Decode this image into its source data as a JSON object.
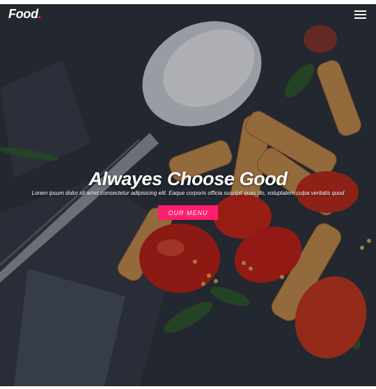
{
  "navbar": {
    "brand": "Food",
    "brand_dot": ".",
    "menu_icon": "hamburger-menu-icon"
  },
  "hero": {
    "headline": "Alwayes Choose Good",
    "subtitle": "Lorem ipsum dolor sit amet consectetur adipisicing elit. Eaque corporis officia suscipit quas illo, voluptatem culpa veritatis quod",
    "cta_label": "OUR MENU",
    "background_image": "pasta-dish-photo"
  },
  "colors": {
    "accent": "#ff1e6e",
    "text": "#ffffff",
    "page_background": "#ffffff"
  }
}
